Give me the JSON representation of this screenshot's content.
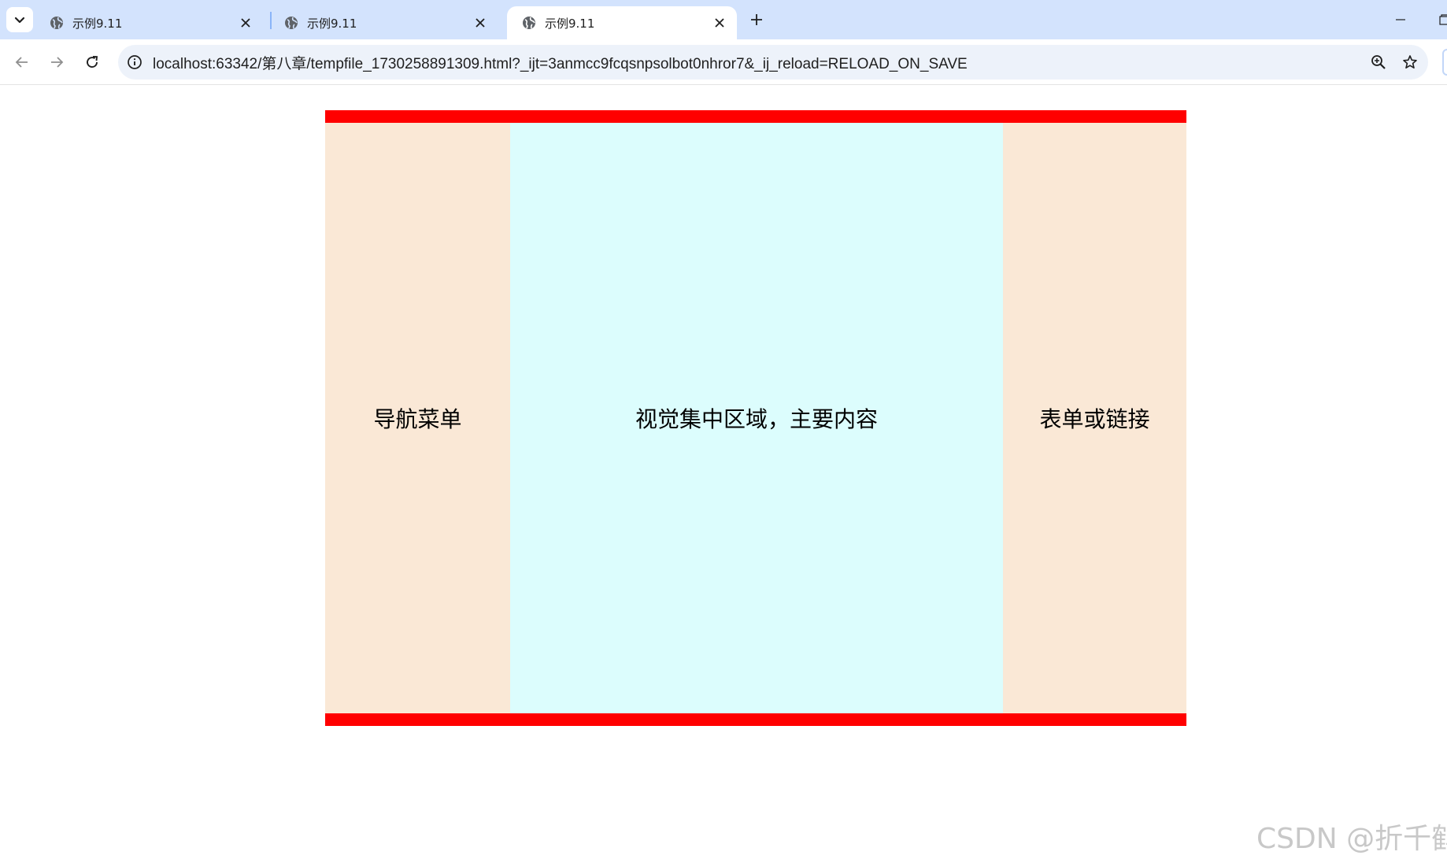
{
  "browser": {
    "tabs": [
      {
        "title": "示例9.11",
        "active": false
      },
      {
        "title": "示例9.11",
        "active": false
      },
      {
        "title": "示例9.11",
        "active": true
      }
    ],
    "address_bar": {
      "url": "localhost:63342/第八章/tempfile_1730258891309.html?_ijt=3anmcc9fcqsnpsolbot0nhror7&_ij_reload=RELOAD_ON_SAVE"
    }
  },
  "page": {
    "left_column": "导航菜单",
    "main_column": "视觉集中区域，主要内容",
    "right_column": "表单或链接",
    "colors": {
      "bar": "#ff0000",
      "side": "#fae8d6",
      "main": "#dcfdfd"
    }
  },
  "watermark": "CSDN @折千鹤",
  "icons": [
    "tab-search-icon",
    "globe-icon",
    "close-icon",
    "plus-icon",
    "minimize-icon",
    "restore-icon",
    "back-arrow-icon",
    "forward-arrow-icon",
    "reload-icon",
    "info-icon",
    "zoom-icon",
    "star-icon"
  ]
}
